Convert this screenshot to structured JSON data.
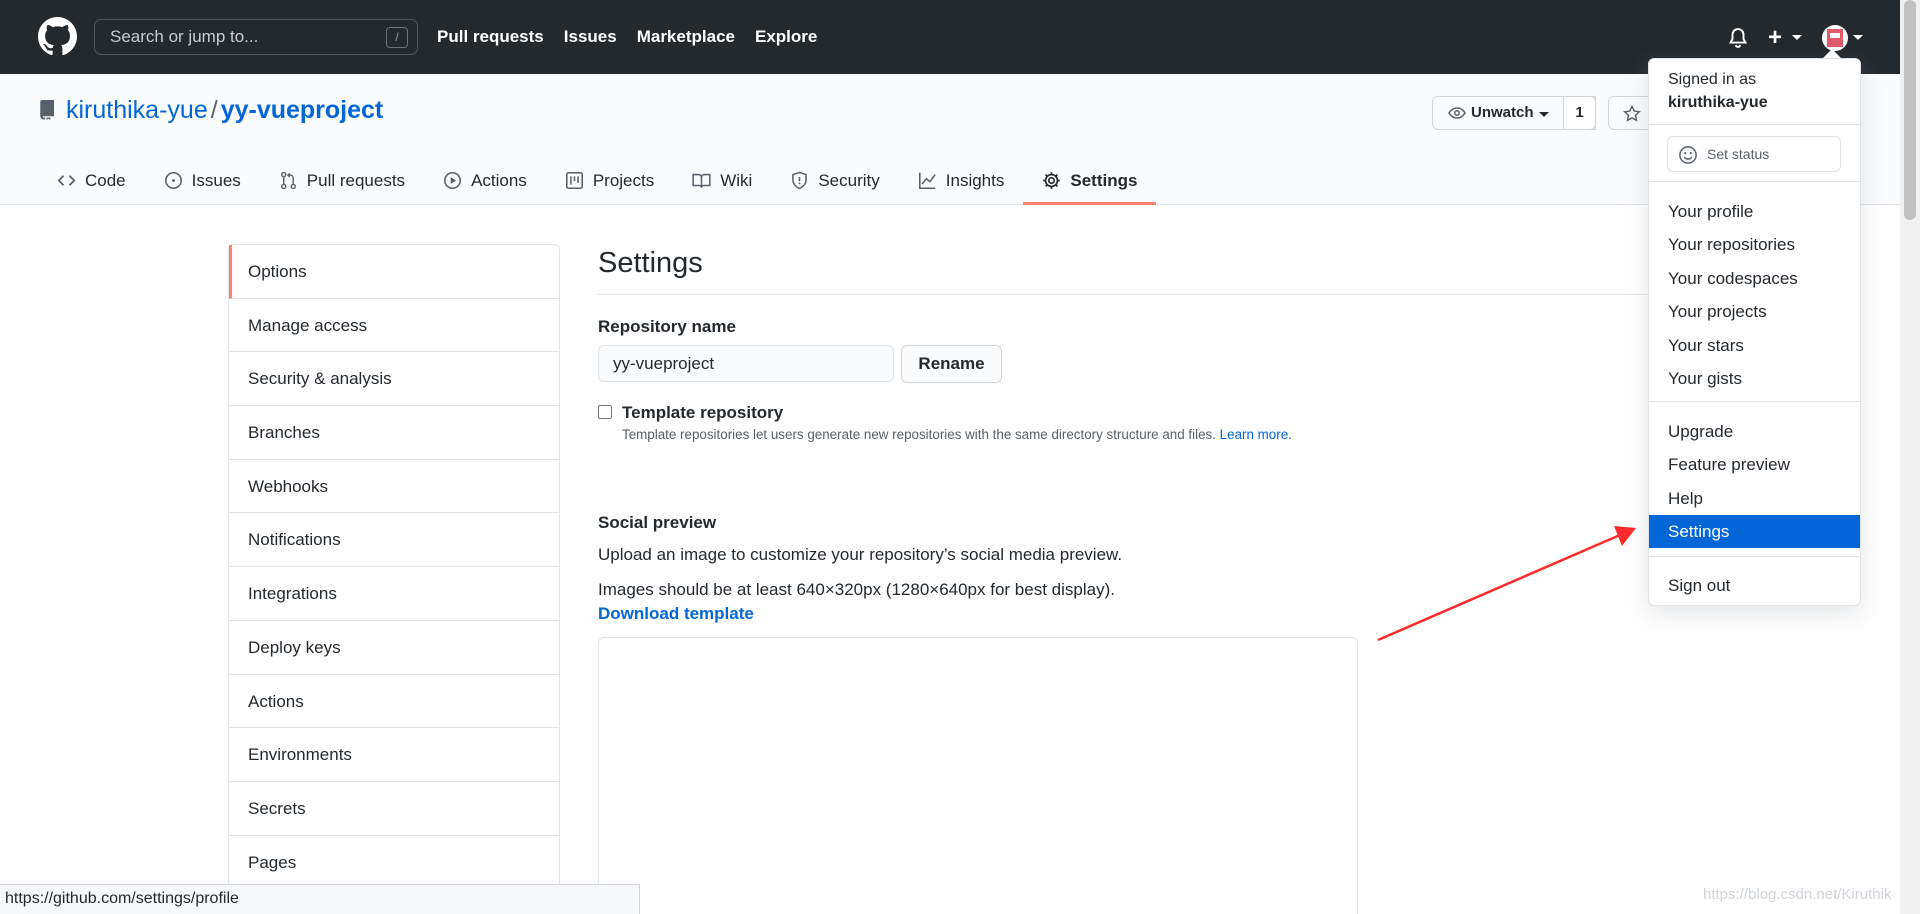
{
  "header": {
    "search_placeholder": "Search or jump to...",
    "search_hotkey": "/",
    "nav": [
      "Pull requests",
      "Issues",
      "Marketplace",
      "Explore"
    ],
    "plus": "+"
  },
  "repo": {
    "owner": "kiruthika-yue",
    "separator": "/",
    "name": "yy-vueproject",
    "watch_label": "Unwatch",
    "watch_count": "1",
    "tabs": [
      {
        "label": "Code",
        "icon": "code-icon"
      },
      {
        "label": "Issues",
        "icon": "issue-icon"
      },
      {
        "label": "Pull requests",
        "icon": "pull-request-icon"
      },
      {
        "label": "Actions",
        "icon": "play-icon"
      },
      {
        "label": "Projects",
        "icon": "project-icon"
      },
      {
        "label": "Wiki",
        "icon": "book-icon"
      },
      {
        "label": "Security",
        "icon": "shield-icon"
      },
      {
        "label": "Insights",
        "icon": "graph-icon"
      },
      {
        "label": "Settings",
        "icon": "gear-icon",
        "active": true
      }
    ]
  },
  "sidebar": {
    "items": [
      "Options",
      "Manage access",
      "Security & analysis",
      "Branches",
      "Webhooks",
      "Notifications",
      "Integrations",
      "Deploy keys",
      "Actions",
      "Environments",
      "Secrets",
      "Pages"
    ],
    "active_index": 0
  },
  "main": {
    "title": "Settings",
    "repo_name_label": "Repository name",
    "repo_name_value": "yy-vueproject",
    "rename_button": "Rename",
    "template_label": "Template repository",
    "template_note": "Template repositories let users generate new repositories with the same directory structure and files.",
    "template_learn_more": "Learn more.",
    "social_title": "Social preview",
    "social_desc": "Upload an image to customize your repository’s social media preview.",
    "social_size": "Images should be at least 640×320px (1280×640px for best display).",
    "download_template": "Download template"
  },
  "user_menu": {
    "signed_in_as": "Signed in as",
    "username": "kiruthika-yue",
    "set_status": "Set status",
    "group1": [
      "Your profile",
      "Your repositories",
      "Your codespaces",
      "Your projects",
      "Your stars",
      "Your gists"
    ],
    "group2": [
      "Upgrade",
      "Feature preview",
      "Help",
      "Settings"
    ],
    "highlighted": "Settings",
    "sign_out": "Sign out"
  },
  "status_bar_url": "https://github.com/settings/profile",
  "watermark": "https://blog.csdn.net/Kiruthik",
  "colors": {
    "header_bg": "#24292e",
    "link_blue": "#0366d6",
    "active_tab_underline": "#f9826c",
    "menu_highlight": "#0366d6",
    "annotation_arrow": "#ff2a2a"
  }
}
